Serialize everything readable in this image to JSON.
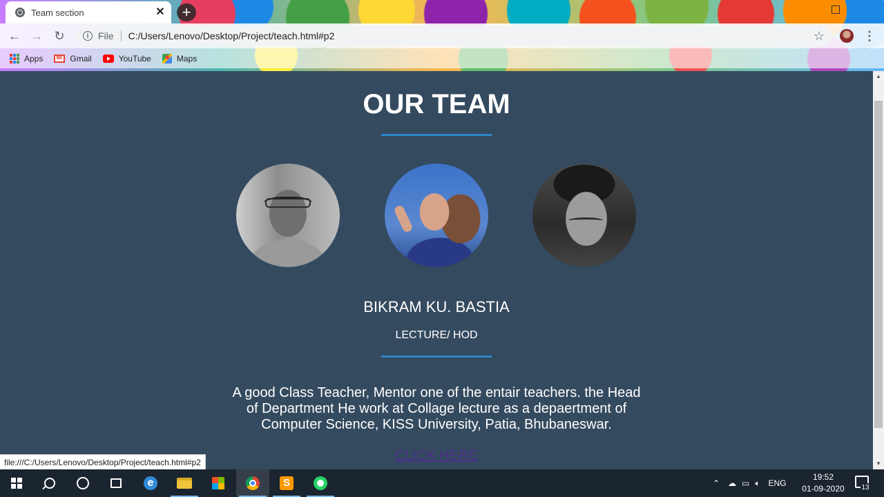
{
  "browser": {
    "tab_title": "Team section",
    "tab_close": "✕",
    "new_tab": "+",
    "url_scheme_label": "File",
    "url": "C:/Users/Lenovo/Desktop/Project/teach.html#p2",
    "bookmarks": [
      {
        "label": "Apps",
        "icon": "apps-icon"
      },
      {
        "label": "Gmail",
        "icon": "gmail-icon"
      },
      {
        "label": "YouTube",
        "icon": "youtube-icon"
      },
      {
        "label": "Maps",
        "icon": "maps-icon"
      }
    ],
    "status_url": "file:///C:/Users/Lenovo/Desktop/Project/teach.html#p2"
  },
  "page": {
    "heading": "OUR TEAM",
    "member": {
      "name": "BIKRAM KU. BASTIA",
      "role": "LECTURE/ HOD",
      "bio": "A good Class Teacher, Mentor one of the entair teachers. the Head of Department He work at Collage lecture as a depaertment of Computer Science, KISS University, Patia, Bhubaneswar."
    },
    "link": "CLICK HERE"
  },
  "taskbar": {
    "language": "ENG",
    "time": "19:52",
    "date": "01-09-2020",
    "notification_count": "13"
  },
  "colors": {
    "page_bg": "#344a5f",
    "accent_rule": "#2e86c9",
    "link": "#4b2f87",
    "taskbar_bg": "#1b2530"
  }
}
